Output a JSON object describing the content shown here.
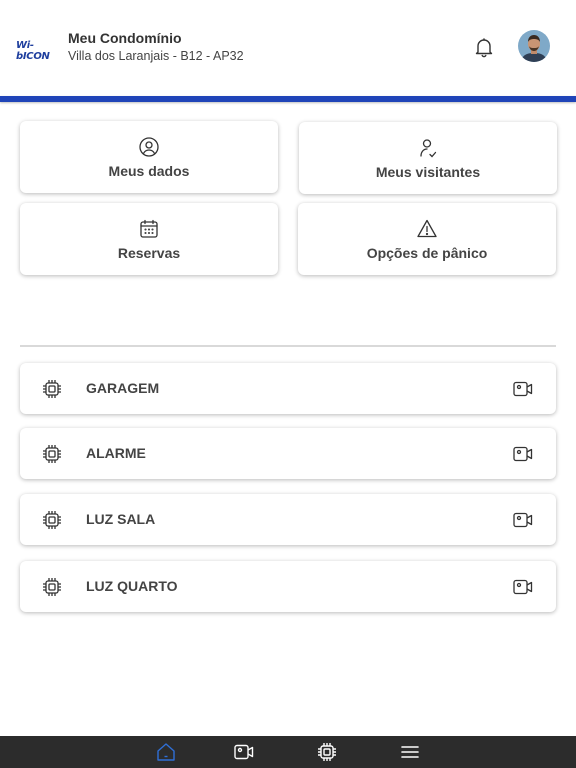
{
  "header": {
    "logo_text": "Wi-bICON",
    "title": "Meu Condomínio",
    "subtitle": "Villa dos Laranjais - B12 - AP32"
  },
  "quick_actions": [
    {
      "label": "Meus dados",
      "icon": "user-circle-icon"
    },
    {
      "label": "Meus visitantes",
      "icon": "user-check-icon"
    },
    {
      "label": "Reservas",
      "icon": "calendar-icon"
    },
    {
      "label": "Opções de pânico",
      "icon": "warning-triangle-icon"
    }
  ],
  "devices": [
    {
      "name": "GARAGEM",
      "icon": "chip-icon",
      "action_icon": "camera-icon"
    },
    {
      "name": "ALARME",
      "icon": "chip-icon",
      "action_icon": "camera-icon"
    },
    {
      "name": "LUZ SALA",
      "icon": "chip-icon",
      "action_icon": "camera-icon"
    },
    {
      "name": "LUZ QUARTO",
      "icon": "chip-icon",
      "action_icon": "camera-icon"
    }
  ],
  "bottom_nav": {
    "items": [
      "home-icon",
      "camera-icon",
      "chip-icon",
      "menu-icon"
    ],
    "active": "home-icon"
  },
  "colors": {
    "brand_blue": "#1f44b8",
    "nav_background": "#2c2c2c",
    "nav_active": "#2f6fd6",
    "nav_inactive": "#ffffff"
  }
}
